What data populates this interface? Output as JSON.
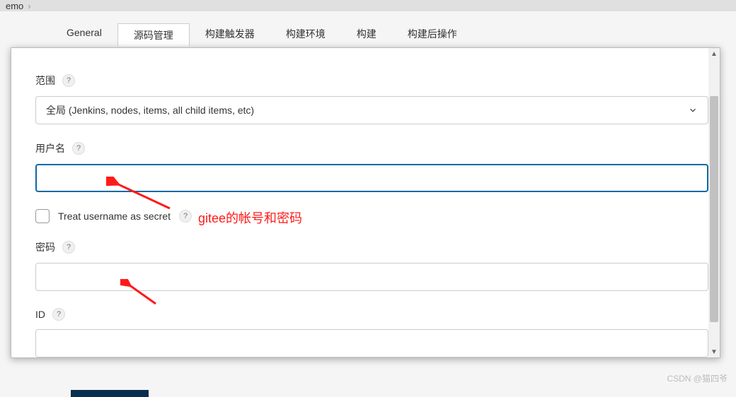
{
  "breadcrumb": {
    "item1": "emo",
    "sep": "›"
  },
  "tabs": [
    {
      "label": "General",
      "active": false
    },
    {
      "label": "源码管理",
      "active": true
    },
    {
      "label": "构建触发器",
      "active": false
    },
    {
      "label": "构建环境",
      "active": false
    },
    {
      "label": "构建",
      "active": false
    },
    {
      "label": "构建后操作",
      "active": false
    }
  ],
  "form": {
    "scope": {
      "label": "范围",
      "selected": "全局 (Jenkins, nodes, items, all child items, etc)"
    },
    "username": {
      "label": "用户名",
      "value": ""
    },
    "treat_secret": {
      "label": "Treat username as secret",
      "checked": false
    },
    "password": {
      "label": "密码",
      "value": ""
    },
    "id": {
      "label": "ID",
      "value": ""
    }
  },
  "annotation": {
    "text": "gitee的帐号和密码"
  },
  "watermark": "CSDN @猫四爷",
  "help_glyph": "?"
}
